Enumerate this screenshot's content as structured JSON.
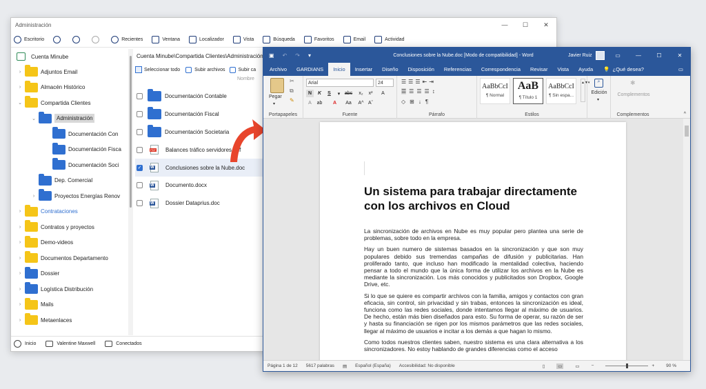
{
  "file_manager": {
    "window_title": "Administración",
    "toolbar": [
      "Escritorio",
      "Recientes",
      "Ventana",
      "Localizador",
      "Vista",
      "Búsqueda",
      "Favoritos",
      "Email",
      "Actividad"
    ],
    "tree_root": "Cuenta Minube",
    "tree": [
      {
        "label": "Adjuntos Email",
        "expanded": false,
        "color": "yellow"
      },
      {
        "label": "Almacén Histórico",
        "expanded": false,
        "color": "yellow"
      },
      {
        "label": "Compartida Clientes",
        "expanded": true,
        "color": "yellow"
      },
      {
        "label": "Administración",
        "expanded": true,
        "color": "blue",
        "selected": true
      },
      {
        "label": "Documentación Con",
        "color": "blue"
      },
      {
        "label": "Documentación Fisca",
        "color": "blue"
      },
      {
        "label": "Documentación Soci",
        "color": "blue"
      },
      {
        "label": "Dep. Comercial",
        "color": "blue"
      },
      {
        "label": "Proyectos Energías Renov",
        "expanded": false,
        "color": "blue"
      },
      {
        "label": "Contrataciones",
        "expanded": false,
        "color": "yellow",
        "highlight": true
      },
      {
        "label": "Contratos y proyectos",
        "expanded": false,
        "color": "yellow"
      },
      {
        "label": "Demo-videos",
        "expanded": false,
        "color": "yellow"
      },
      {
        "label": "Documentos Departamento",
        "expanded": false,
        "color": "yellow"
      },
      {
        "label": "Dossier",
        "expanded": false,
        "color": "blue"
      },
      {
        "label": "Logística Distribución",
        "expanded": false,
        "color": "blue"
      },
      {
        "label": "Mails",
        "expanded": false,
        "color": "yellow"
      },
      {
        "label": "Metaenlaces",
        "expanded": false,
        "color": "yellow"
      }
    ],
    "path": "Cuenta Minube\\Compartida Clientes\\Administración",
    "file_toolbar": {
      "select_all": "Seleccionar todo",
      "upload": "Subir archivos",
      "more": "Subir ca"
    },
    "column_name": "Nombre",
    "files": [
      {
        "name": "Documentación Contable",
        "type": "folder"
      },
      {
        "name": "Documentación Fiscal",
        "type": "folder"
      },
      {
        "name": "Documentación Societaria",
        "type": "folder"
      },
      {
        "name": "Balances tráfico servidores.pdf",
        "type": "pdf"
      },
      {
        "name": "Conclusiones sobre la Nube.doc",
        "type": "word",
        "selected": true
      },
      {
        "name": "Documento.docx",
        "type": "word"
      },
      {
        "name": "Dossier Dataprius.doc",
        "type": "word"
      }
    ],
    "status": {
      "home": "Inicio",
      "user": "Valentine Maxwell",
      "connection": "Conectados"
    }
  },
  "word": {
    "title": "Conclusiones sobre la Nube.doc [Modo de compatibilidad] - Word",
    "user": "Javier Ruiz",
    "tabs": [
      "Archivo",
      "GARDIANS",
      "Inicio",
      "Insertar",
      "Diseño",
      "Disposición",
      "Referencias",
      "Correspondencia",
      "Revisar",
      "Vista",
      "Ayuda"
    ],
    "active_tab": "Inicio",
    "help": "¿Qué desea?",
    "ribbon": {
      "paste": "Pegar",
      "font_name": "Arial",
      "font_size": "24",
      "groups": [
        "Portapapeles",
        "Fuente",
        "Párrafo",
        "Estilos",
        "Edición",
        "Complementos"
      ],
      "styles": [
        {
          "sample": "AaBbCcI",
          "name": "¶ Normal"
        },
        {
          "sample": "AaB",
          "name": "¶ Título 1"
        },
        {
          "sample": "AaBbCcI",
          "name": "¶ Sin espa..."
        }
      ],
      "editing": "Edición",
      "addins": "Complementos"
    },
    "doc": {
      "heading": "Un sistema para trabajar directamente con los archivos en Cloud",
      "paragraphs": [
        "La sincronización de archivos en Nube es muy popular pero plantea una serie de problemas, sobre todo en la empresa.",
        "Hay un buen numero de sistemas basados en la sincronización y que son muy populares debido sus tremendas campañas de difusión y publicitarias. Han proliferado tanto, que incluso han modificado la mentalidad colectiva, haciendo pensar a todo el mundo que la única forma de utilizar los archivos en la Nube es mediante la sincronización. Los más conocidos y publicitados son Dropbox, Google Drive, etc.",
        "Si lo que se quiere es compartir archivos con la familia, amigos y contactos con gran eficacia, sin control, sin privacidad y sin trabas, entonces la sincronización es ideal, funciona como las redes sociales, donde intentamos llegar al máximo de usuarios. De hecho, están más bien diseñados para esto. Su forma de operar, su razón de ser y hasta su financiación se rigen por los mismos parámetros que las redes sociales, llegar al máximo de usuarios e incitar a los demás a que hagan lo mismo.",
        "Como todos nuestros clientes saben, nuestro sistema es una clara alternativa a los sincronizadores. No estoy hablando de grandes diferencias como el acceso"
      ]
    },
    "status": {
      "page": "Página 1 de 12",
      "words": "5617 palabras",
      "lang": "Español (España)",
      "access": "Accesibilidad: No disponible",
      "zoom": "90 %",
      "zoom_level": 0.5
    }
  }
}
